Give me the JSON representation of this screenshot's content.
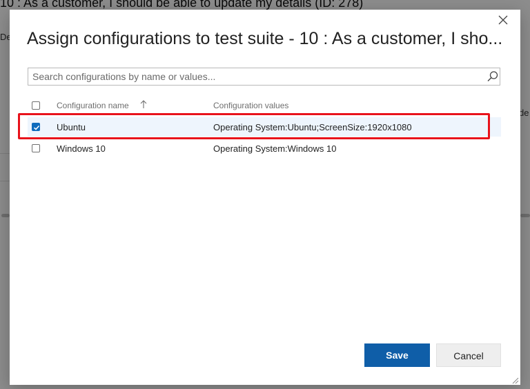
{
  "background": {
    "title": "10 : As a customer, I should be able to update my details (ID: 278)",
    "left_tab": "De",
    "right_tab": "de"
  },
  "dialog": {
    "title": "Assign configurations to test suite - 10 : As a customer, I sho...",
    "close_icon": "close-icon",
    "search": {
      "placeholder": "Search configurations by name or values...",
      "value": "",
      "icon": "search-icon"
    },
    "grid": {
      "columns": [
        "Configuration name",
        "Configuration values"
      ],
      "sort_indicator": "ascending",
      "rows": [
        {
          "name": "Ubuntu",
          "values": "Operating System:Ubuntu;ScreenSize:1920x1080",
          "checked": true
        },
        {
          "name": "Windows 10",
          "values": "Operating System:Windows 10",
          "checked": false
        }
      ]
    },
    "buttons": {
      "save": "Save",
      "cancel": "Cancel"
    }
  },
  "colors": {
    "primary": "#0f5ea8",
    "checkbox_checked": "#0f6cbd",
    "highlight": "#e8121b",
    "selected_row": "#eef5fd"
  }
}
